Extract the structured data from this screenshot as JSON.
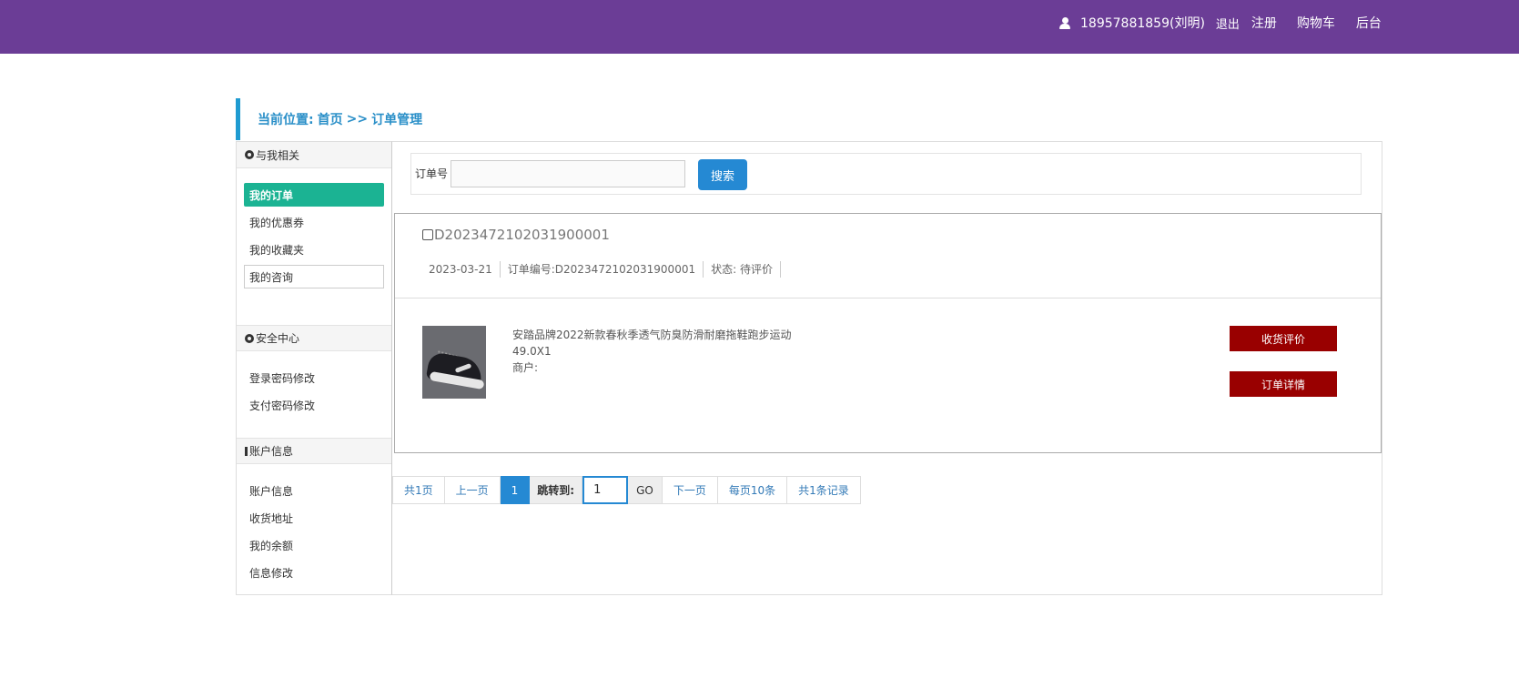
{
  "header": {
    "user": "18957881859(刘明)",
    "logout": "退出",
    "register": "注册",
    "cart": "购物车",
    "admin": "后台"
  },
  "breadcrumb": {
    "label": "当前位置:",
    "home": "首页",
    "sep": ">>",
    "current": "订单管理"
  },
  "sidebar": {
    "section1": {
      "title": "与我相关",
      "items": [
        "我的订单",
        "我的优惠券",
        "我的收藏夹",
        "我的咨询"
      ]
    },
    "section2": {
      "title": "安全中心",
      "items": [
        "登录密码修改",
        "支付密码修改"
      ]
    },
    "section3": {
      "title": "账户信息",
      "items": [
        "账户信息",
        "收货地址",
        "我的余额",
        "信息修改"
      ]
    }
  },
  "search": {
    "label": "订单号",
    "value": "",
    "button": "搜索"
  },
  "order": {
    "id": "D2023472102031900001",
    "date": "2023-03-21",
    "number": "订单编号:D2023472102031900001",
    "status": "状态: 待评价",
    "product_name": "安踏品牌2022新款春秋季透气防臭防滑耐磨拖鞋跑步运动",
    "price_qty": "49.0X1",
    "merchant": "商户:",
    "btn_review": "收货评价",
    "btn_detail": "订单详情"
  },
  "pager": {
    "total_pages": "共1页",
    "prev": "上一页",
    "current": "1",
    "jump_label": "跳转到:",
    "jump_value": "1",
    "go": "GO",
    "next": "下一页",
    "per_page": "每页10条",
    "total_records": "共1条记录"
  },
  "colors": {
    "topbar": "#6b3d96",
    "active_item": "#1bb393",
    "primary": "#2589d3",
    "danger_button": "#990000"
  }
}
